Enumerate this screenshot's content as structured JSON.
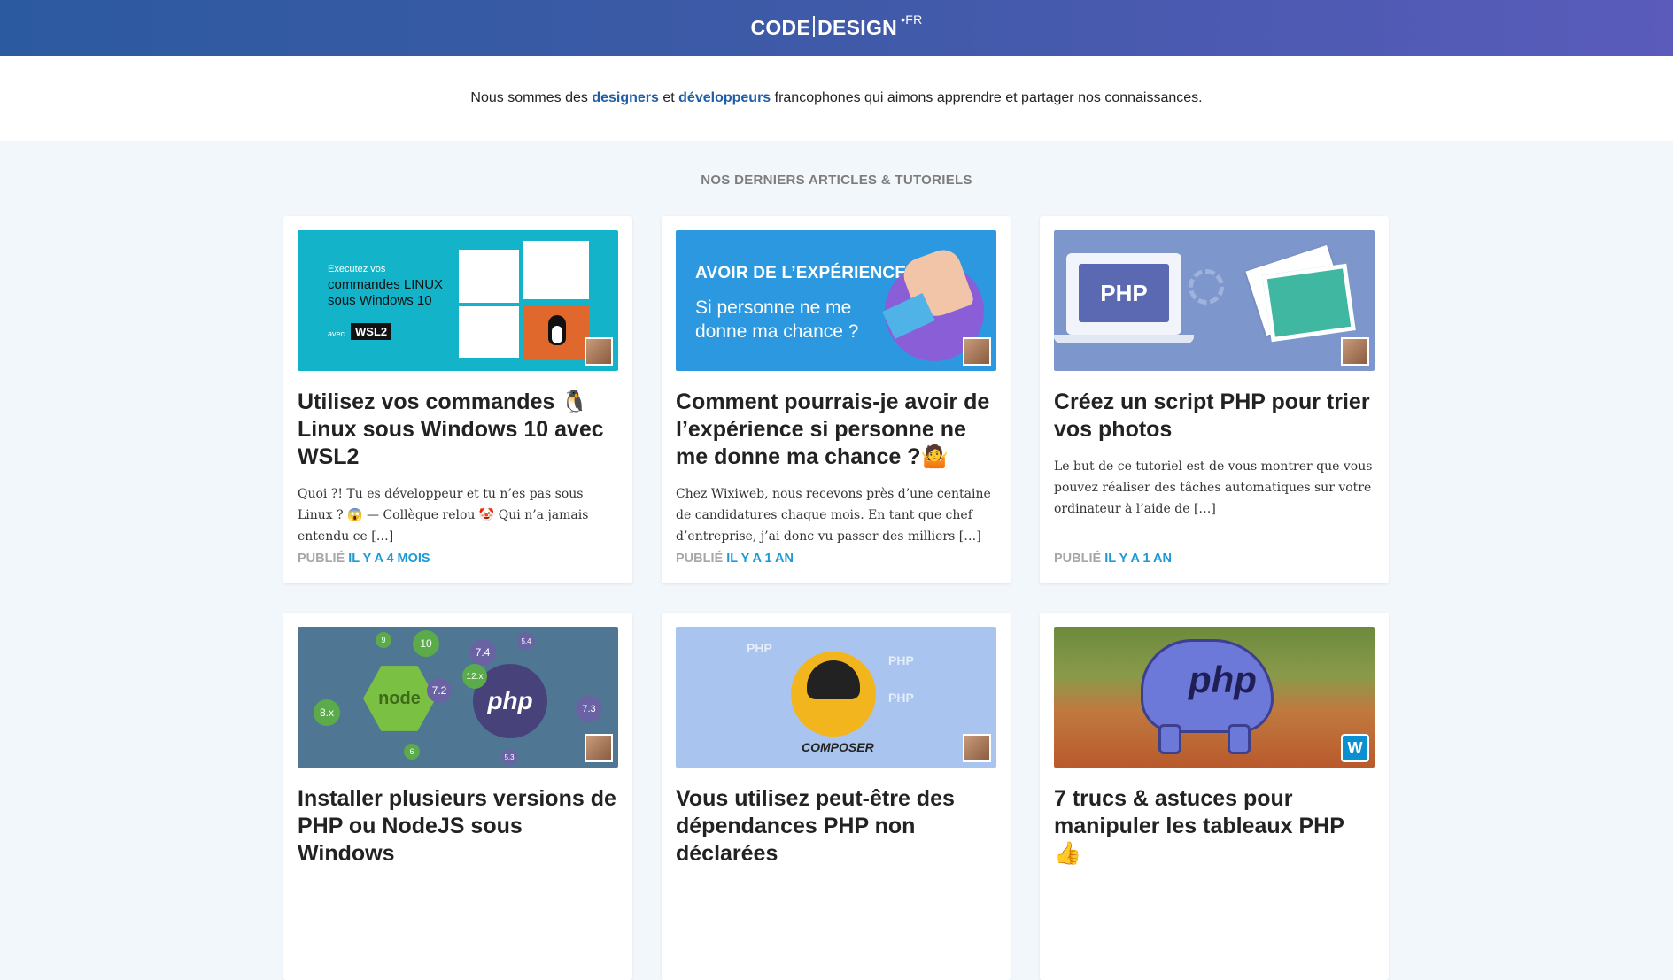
{
  "header": {
    "logo_left": "CODE",
    "logo_right": "DESIGN",
    "logo_tld": "•FR"
  },
  "intro": {
    "before": "Nous sommes des ",
    "designers": "designers",
    "and": " et ",
    "developers": "développeurs",
    "after": " francophones qui aimons apprendre et partager nos connaissances."
  },
  "section_title": "NOS DERNIERS ARTICLES & TUTORIELS",
  "published_label": "PUBLIÉ",
  "articles": [
    {
      "title": "Utilisez vos commandes 🐧Linux sous Windows 10 avec WSL2",
      "excerpt": "Quoi ?! Tu es développeur et tu n’es pas sous Linux ? 😱 — Collègue relou 🤡 Qui n’a jamais entendu ce […]",
      "when": "IL Y A 4 MOIS",
      "thumb": {
        "line1": "Executez vos",
        "line2": "commandes LINUX",
        "line3": "sous Windows 10",
        "line4": "avec",
        "badge": "WSL2"
      }
    },
    {
      "title": "Comment pourrais-je avoir de l’expérience si personne ne me donne ma chance ?🤷",
      "excerpt": "Chez Wixiweb, nous recevons près d’une centaine de candidatures chaque mois. En tant que chef d’entreprise, j’ai donc vu passer des milliers […]",
      "when": "IL Y A 1 AN",
      "thumb": {
        "line1": "AVOIR DE L’EXPÉRIENCE",
        "line2": "Si personne ne me",
        "line3": "donne ma chance ?"
      }
    },
    {
      "title": "Créez un script PHP pour trier vos photos",
      "excerpt": "Le but de ce tutoriel est de vous montrer que vous pouvez réaliser des tâches automatiques sur votre ordinateur à l’aide de […]",
      "when": "IL Y A 1 AN",
      "thumb": {
        "label": "PHP"
      }
    },
    {
      "title": "Installer plusieurs versions de PHP ou NodeJS sous Windows",
      "excerpt": "",
      "when": "",
      "thumb": {
        "node": "node",
        "php": "php",
        "bubbles": [
          "9",
          "10",
          "7.4",
          "5.4",
          "12.x",
          "7.2",
          "8.x",
          "6",
          "7.3",
          "5.3"
        ]
      }
    },
    {
      "title": "Vous utilisez peut-être des dépendances PHP non déclarées",
      "excerpt": "",
      "when": "",
      "thumb": {
        "label": "COMPOSER",
        "php_a": "PHP",
        "php_b": "PHP",
        "php_c": "PHP"
      }
    },
    {
      "title": "7 trucs & astuces pour manipuler les tableaux PHP 👍",
      "excerpt": "",
      "when": "",
      "thumb": {
        "label": "php",
        "badge": "W"
      }
    }
  ]
}
